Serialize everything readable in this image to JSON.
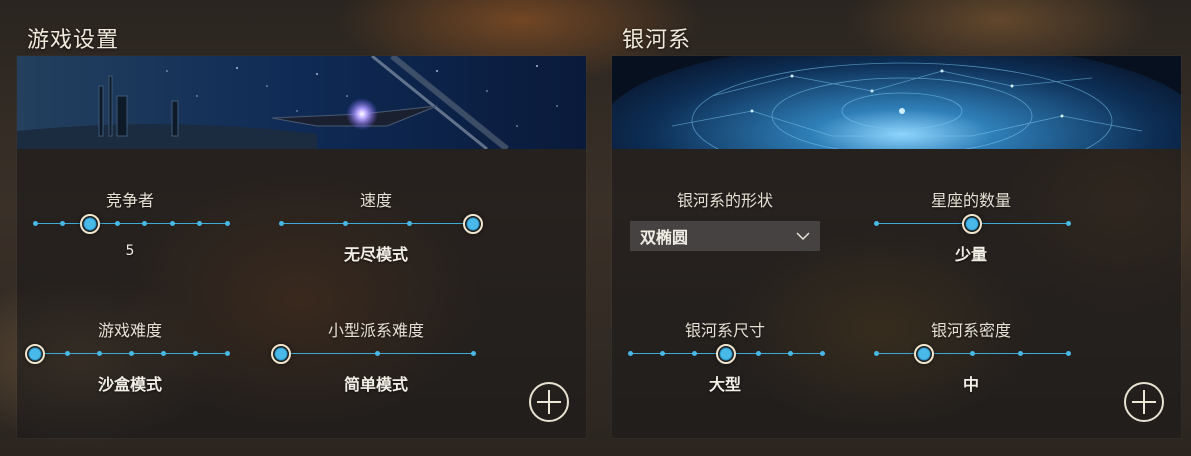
{
  "game_settings": {
    "title": "游戏设置",
    "competitors": {
      "label": "竞争者",
      "value": "5",
      "steps": 8,
      "index": 2
    },
    "speed": {
      "label": "速度",
      "value": "无尽模式",
      "steps": 4,
      "index": 3
    },
    "difficulty": {
      "label": "游戏难度",
      "value": "沙盒模式",
      "steps": 7,
      "index": 0
    },
    "minor_faction_difficulty": {
      "label": "小型派系难度",
      "value": "简单模式",
      "steps": 3,
      "index": 0
    }
  },
  "galaxy": {
    "title": "银河系",
    "shape": {
      "label": "银河系的形状",
      "value": "双椭圆"
    },
    "constellations": {
      "label": "星座的数量",
      "value": "少量",
      "steps": 3,
      "index": 1
    },
    "size": {
      "label": "银河系尺寸",
      "value": "大型",
      "steps": 7,
      "index": 3
    },
    "density": {
      "label": "银河系密度",
      "value": "中",
      "steps": 5,
      "index": 1
    }
  },
  "icons": {
    "add": "plus-circle-icon",
    "dropdown": "chevron-down-icon"
  },
  "colors": {
    "accent": "#48b8e6",
    "thumb_ring": "#f0e6cf"
  }
}
